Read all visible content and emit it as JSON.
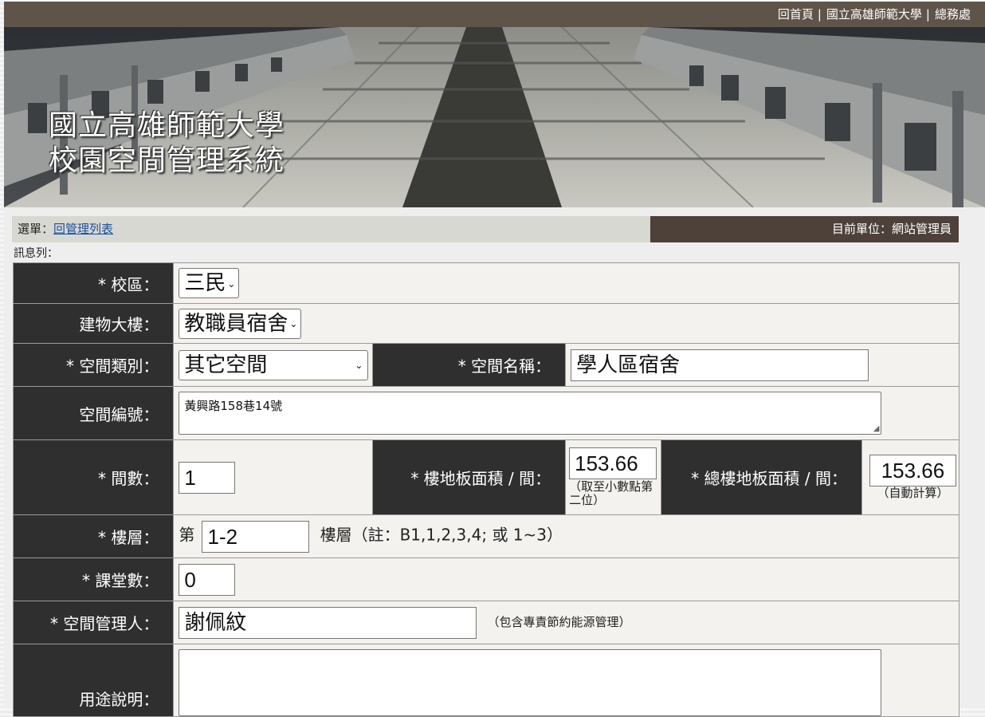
{
  "top_nav": {
    "items": [
      "回首頁",
      "國立高雄師範大學",
      "總務處"
    ],
    "separator": "|"
  },
  "banner": {
    "title_line1": "國立高雄師範大學",
    "title_line2": "校園空間管理系統"
  },
  "menu": {
    "label": "選單：",
    "link": "回管理列表",
    "current_unit": "目前單位：網站管理員"
  },
  "message_bar": {
    "label": "訊息列："
  },
  "form": {
    "campus": {
      "label": "* 校區：",
      "value": "三民"
    },
    "building": {
      "label": "建物大樓：",
      "value": "教職員宿舍"
    },
    "space_type": {
      "label": "* 空間類別：",
      "value": "其它空間"
    },
    "space_name": {
      "label": "* 空間名稱：",
      "value": "學人區宿舍"
    },
    "space_code": {
      "label": "空間編號：",
      "value": "黃興路158巷14號"
    },
    "room_count": {
      "label": "* 間數：",
      "value": "1"
    },
    "floor_area": {
      "label": "* 樓地板面積 / 間：",
      "value": "153.66",
      "hint": "（取至小數點第二位）"
    },
    "total_area": {
      "label": "* 總樓地板面積 / 間：",
      "value": "153.66",
      "hint": "（自動計算）"
    },
    "floor": {
      "label": "* 樓層：",
      "prefix": "第",
      "value": "1-2",
      "suffix": "樓層（註：B1,1,2,3,4; 或 1~3）"
    },
    "classrooms": {
      "label": "* 課堂數：",
      "value": "0"
    },
    "manager": {
      "label": "* 空間管理人：",
      "value": "謝佩紋",
      "hint": "（包含專責節約能源管理）"
    },
    "usage": {
      "label": "用途說明：",
      "value": ""
    }
  },
  "colors": {
    "topbar": "#5f5449",
    "label_cell": "#2f2f2f",
    "unit_box": "#4d413a",
    "value_cell": "#f3f2ee",
    "link": "#1a4f9c"
  }
}
